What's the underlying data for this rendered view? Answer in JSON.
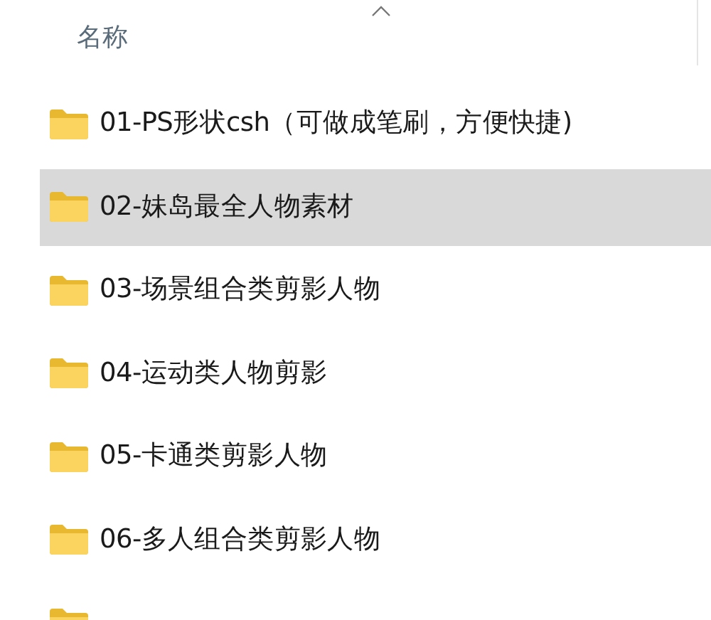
{
  "header": {
    "label": "名称",
    "sort_ascending": true
  },
  "folders": [
    {
      "name": "01-PS形状csh（可做成笔刷，方便快捷)",
      "selected": false
    },
    {
      "name": "02-妹岛最全人物素材",
      "selected": true
    },
    {
      "name": "03-场景组合类剪影人物",
      "selected": false
    },
    {
      "name": "04-运动类人物剪影",
      "selected": false
    },
    {
      "name": "05-卡通类剪影人物",
      "selected": false
    },
    {
      "name": "06-多人组合类剪影人物",
      "selected": false
    }
  ]
}
